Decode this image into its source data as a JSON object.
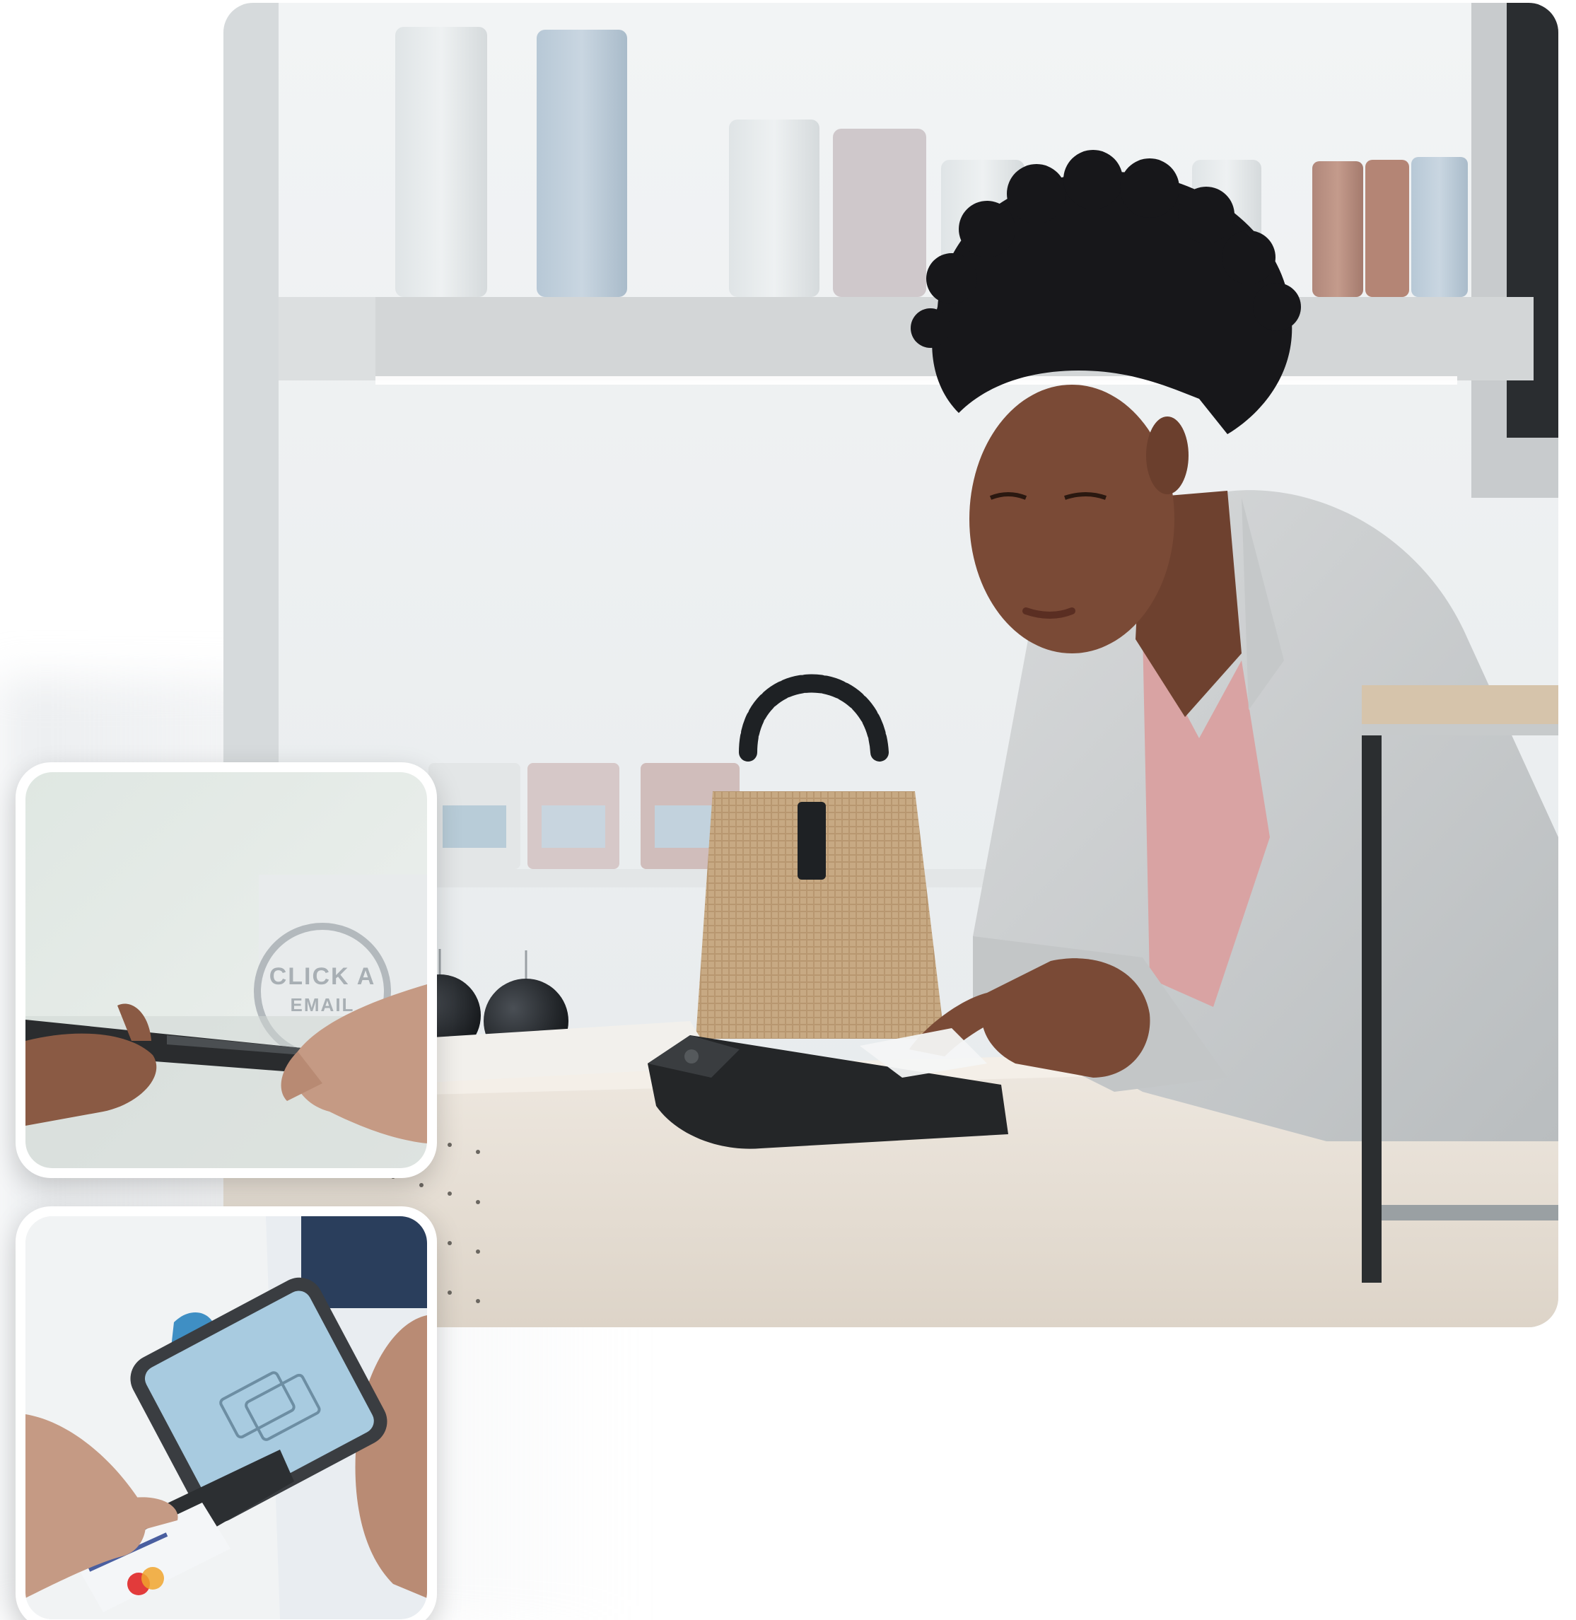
{
  "scene": {
    "main_photo": "retail-checkout-woman-using-card-terminal",
    "inset_top": "hands-handing-over-handheld-payment-device",
    "inset_bottom": "hands-inserting-card-into-smartphone-card-reader"
  },
  "bag_logo": {
    "line1": "CLICK A",
    "line2": "EMAIL"
  },
  "colors": {
    "wall": "#eef1f3",
    "shelf": "#d9dcdd",
    "counter": "#e9e2d8",
    "jacket": "#c9cccd",
    "blouse": "#d9a3a3",
    "skin": "#7a4a36",
    "hair": "#17171a",
    "terminal": "#242628",
    "basket": "#c9ab86",
    "screen": "#9fc6df"
  }
}
